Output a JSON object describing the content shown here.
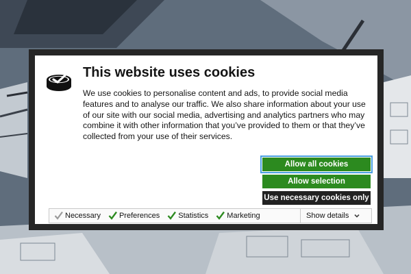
{
  "dialog": {
    "title": "This website uses cookies",
    "body": "We use cookies to personalise content and ads, to provide social media features and to analyse our traffic. We also share information about your use of our site with our social media, advertising and analytics partners who may combine it with other information that you’ve provided to them or that they’ve collected from your use of their services."
  },
  "buttons": {
    "allow_all": "Allow all cookies",
    "allow_selection": "Allow selection",
    "necessary_only": "Use necessary cookies only"
  },
  "categories": [
    {
      "label": "Necessary",
      "checked": true,
      "disabled": true
    },
    {
      "label": "Preferences",
      "checked": true,
      "disabled": false
    },
    {
      "label": "Statistics",
      "checked": true,
      "disabled": false
    },
    {
      "label": "Marketing",
      "checked": true,
      "disabled": false
    }
  ],
  "details": {
    "label": "Show details",
    "icon": "chevron-down-icon"
  },
  "colors": {
    "accent_green": "#2c8a1f",
    "dark_button": "#222222",
    "focus_ring": "#4a9fe0"
  }
}
